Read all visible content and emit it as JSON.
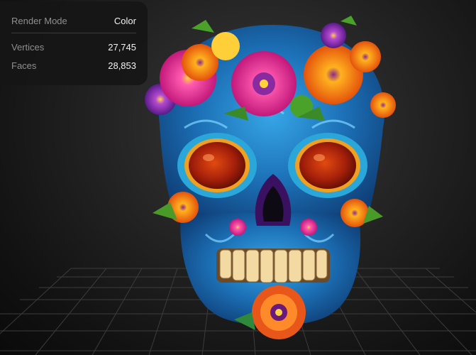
{
  "stats": {
    "render_mode_label": "Render Mode",
    "render_mode_value": "Color",
    "vertices_label": "Vertices",
    "vertices_value": "27,745",
    "faces_label": "Faces",
    "faces_value": "28,853"
  },
  "colors": {
    "background": "#0d0d0d",
    "panel": "#161616",
    "grid_line": "#3a3a3a",
    "skull_blue": "#1f7fc4",
    "eye_red": "#c0300a",
    "flower_pink": "#ff5fb0",
    "flower_orange": "#ff7a1a"
  },
  "scene": {
    "model_icon": "painted-skull-model",
    "floor_icon": "ground-grid"
  }
}
